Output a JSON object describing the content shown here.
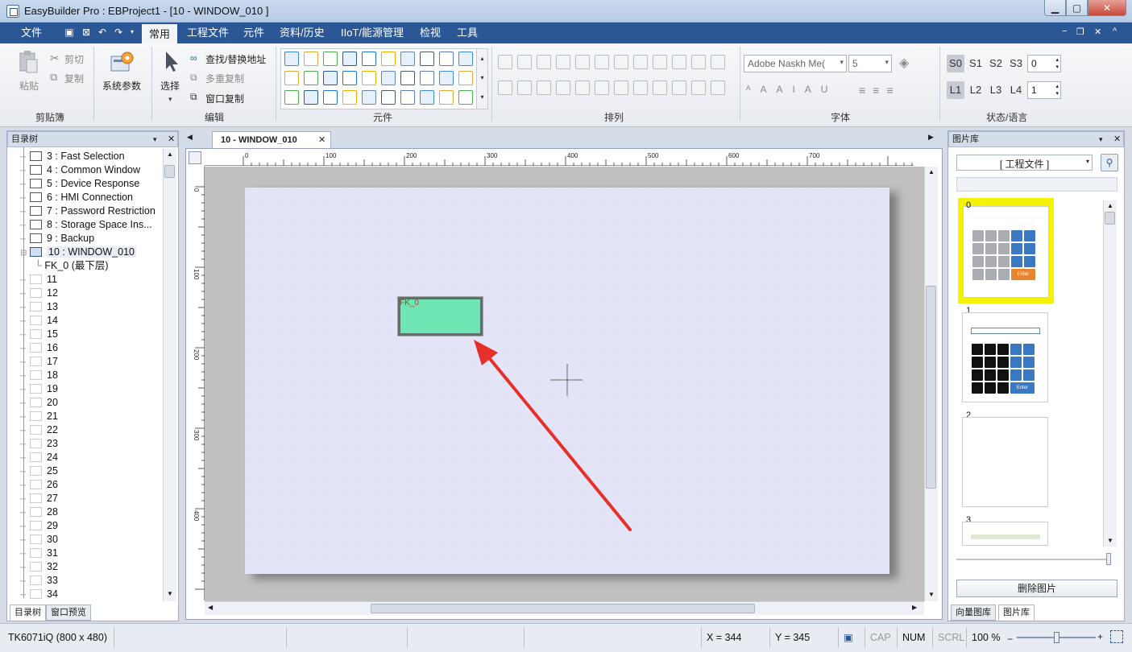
{
  "window": {
    "title": "EasyBuilder Pro : EBProject1 - [10 - WINDOW_010 ]",
    "min_glyph": "▁",
    "max_glyph": "▢",
    "close_glyph": "✕"
  },
  "menu": {
    "file": "文件",
    "items": [
      "常用",
      "工程文件",
      "元件",
      "资料/历史",
      "IIoT/能源管理",
      "检视",
      "工具"
    ],
    "mdi_controls": [
      "−",
      "❐",
      "✕",
      "^"
    ]
  },
  "ribbon": {
    "clipboard": {
      "paste": "粘贴",
      "cut": "剪切",
      "copy": "复制",
      "label": "剪贴簿"
    },
    "system_params": "系统参数",
    "edit": {
      "select": "选择",
      "find_replace": "查找/替换地址",
      "multi_copy": "多重复制",
      "window_copy": "窗口复制",
      "label": "编辑"
    },
    "objects_label": "元件",
    "arrange_label": "排列",
    "font": {
      "family": "Adobe Naskh Me(",
      "size": "5",
      "label": "字体"
    },
    "state": {
      "states": [
        "S0",
        "S1",
        "S2",
        "S3"
      ],
      "state_value": "0",
      "languages": [
        "L1",
        "L2",
        "L3",
        "L4"
      ],
      "language_value": "1",
      "label": "状态/语言"
    }
  },
  "left_panel": {
    "title": "目录树",
    "items": [
      {
        "label": "3 : Fast Selection",
        "type": "window"
      },
      {
        "label": "4 : Common Window",
        "type": "window"
      },
      {
        "label": "5 : Device Response",
        "type": "window"
      },
      {
        "label": "6 : HMI Connection",
        "type": "window"
      },
      {
        "label": "7 : Password Restriction",
        "type": "window"
      },
      {
        "label": "8 : Storage Space Ins...",
        "type": "window"
      },
      {
        "label": "9 : Backup",
        "type": "window"
      },
      {
        "label": "10 : WINDOW_010",
        "type": "selected"
      },
      {
        "label": "FK_0 (最下层)",
        "type": "child"
      },
      {
        "label": "11",
        "type": "blank"
      },
      {
        "label": "12",
        "type": "blank"
      },
      {
        "label": "13",
        "type": "blank"
      },
      {
        "label": "14",
        "type": "blank"
      },
      {
        "label": "15",
        "type": "blank"
      },
      {
        "label": "16",
        "type": "blank"
      },
      {
        "label": "17",
        "type": "blank"
      },
      {
        "label": "18",
        "type": "blank"
      },
      {
        "label": "19",
        "type": "blank"
      },
      {
        "label": "20",
        "type": "blank"
      },
      {
        "label": "21",
        "type": "blank"
      },
      {
        "label": "22",
        "type": "blank"
      },
      {
        "label": "23",
        "type": "blank"
      },
      {
        "label": "24",
        "type": "blank"
      },
      {
        "label": "25",
        "type": "blank"
      },
      {
        "label": "26",
        "type": "blank"
      },
      {
        "label": "27",
        "type": "blank"
      },
      {
        "label": "28",
        "type": "blank"
      },
      {
        "label": "29",
        "type": "blank"
      },
      {
        "label": "30",
        "type": "blank"
      },
      {
        "label": "31",
        "type": "blank"
      },
      {
        "label": "32",
        "type": "blank"
      },
      {
        "label": "33",
        "type": "blank"
      },
      {
        "label": "34",
        "type": "blank"
      }
    ],
    "tabs": [
      "目录树",
      "窗口预览"
    ]
  },
  "editor": {
    "tab_label": "10 - WINDOW_010",
    "ruler_h": [
      "0",
      "100",
      "200",
      "300",
      "400",
      "500",
      "600",
      "700"
    ],
    "ruler_v": [
      "0",
      "100",
      "200",
      "300",
      "400"
    ],
    "object_label": "FK_0"
  },
  "right_panel": {
    "title": "图片库",
    "source": "[ 工程文件 ]",
    "cards": [
      "0",
      "1",
      "2",
      "3"
    ],
    "keypad_enter": "Enter",
    "bottom_button": "删除图片",
    "tabs": [
      "向量图库",
      "图片库"
    ]
  },
  "status": {
    "model": "TK6071iQ (800 x 480)",
    "x": "X = 344",
    "y": "Y = 345",
    "cap": "CAP",
    "num": "NUM",
    "scrl": "SCRL",
    "zoom": "100 %"
  },
  "colors": {
    "accent": "#2b5797",
    "object_fill": "#6ee6b4",
    "page_bg": "#e4e4f8",
    "highlight": "#f5f200",
    "arrow": "#e8302a"
  }
}
